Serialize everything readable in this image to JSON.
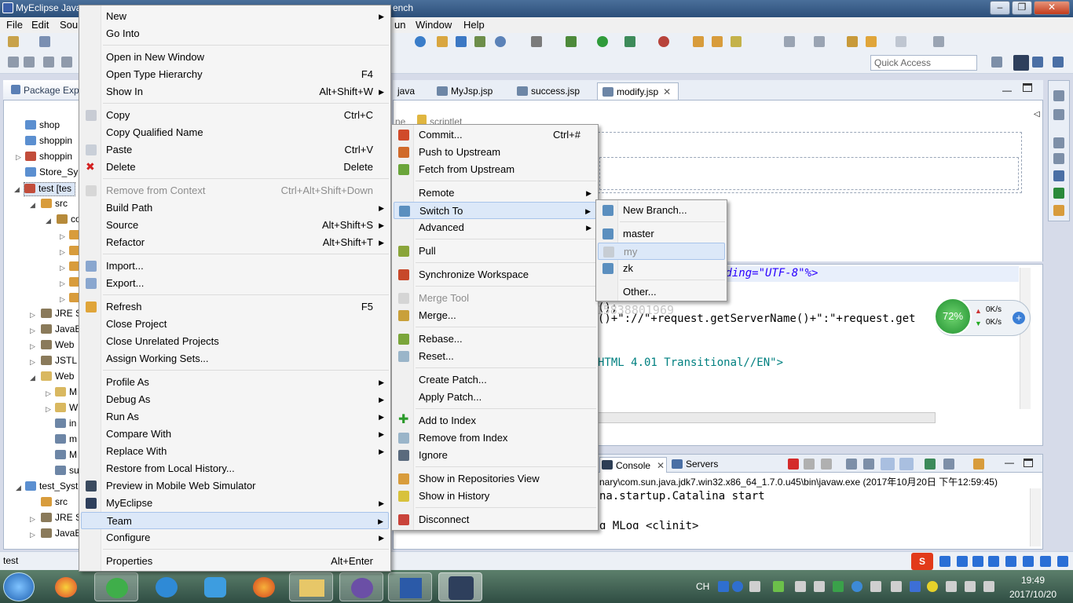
{
  "window": {
    "title": "MyEclipse Java",
    "title_suffix": "ench"
  },
  "menubar": {
    "items": [
      "File",
      "Edit",
      "Sou",
      "un",
      "Window",
      "Help"
    ]
  },
  "toolbar": {
    "quick_access_placeholder": "Quick Access"
  },
  "package_explorer": {
    "title": "Package Expl",
    "rows": [
      "shop",
      "shoppin",
      "shoppin",
      "Store_Sy",
      "test [tes",
      "src",
      "co",
      "",
      "",
      "",
      "",
      "",
      "JRE S",
      "JavaE",
      "Web",
      "JSTL",
      "Web",
      "M",
      "W",
      "in",
      "m",
      "M",
      "su",
      "test_Syst",
      "src",
      "JRE S",
      "JavaE"
    ]
  },
  "editor": {
    "tabs": [
      "java",
      "MyJsp.jsp",
      "success.jsp",
      "modify.jsp"
    ],
    "design_fragments": [
      "ne",
      "scriptlet"
    ],
    "code_lines": [
      "oding=\"UTF-8\"%>",
      "();",
      "()+\"://\"+request.getServerName()+\":\"+request.get",
      "HTML 4.01 Transitional//EN\">"
    ],
    "watermark": "http://blog.csdn.net/a15838801969"
  },
  "console": {
    "tabs": [
      "Console",
      "Servers"
    ],
    "path_line": "nary\\com.sun.java.jdk7.win32.x86_64_1.7.0.u45\\bin\\javaw.exe (2017年10月20日 下午12:59:45)",
    "lines": [
      "na.startup.Catalina start",
      "g MLog <clinit>"
    ]
  },
  "perf_widget": {
    "percent": "72%",
    "up": "0K/s",
    "down": "0K/s"
  },
  "status": {
    "text": "test"
  },
  "taskbar": {
    "time": "19:49",
    "date": "2017/10/20",
    "lang": "CH"
  },
  "context_menu": {
    "items": [
      {
        "label": "New",
        "shortcut": "",
        "submenu": true
      },
      {
        "label": "Go Into",
        "shortcut": ""
      },
      {
        "label": "Open in New Window",
        "shortcut": ""
      },
      {
        "label": "Open Type Hierarchy",
        "shortcut": "F4"
      },
      {
        "label": "Show In",
        "shortcut": "Alt+Shift+W",
        "submenu": true
      },
      {
        "label": "Copy",
        "shortcut": "Ctrl+C"
      },
      {
        "label": "Copy Qualified Name",
        "shortcut": ""
      },
      {
        "label": "Paste",
        "shortcut": "Ctrl+V"
      },
      {
        "label": "Delete",
        "shortcut": "Delete"
      },
      {
        "label": "Remove from Context",
        "shortcut": "Ctrl+Alt+Shift+Down",
        "disabled": true
      },
      {
        "label": "Build Path",
        "shortcut": "",
        "submenu": true
      },
      {
        "label": "Source",
        "shortcut": "Alt+Shift+S",
        "submenu": true
      },
      {
        "label": "Refactor",
        "shortcut": "Alt+Shift+T",
        "submenu": true
      },
      {
        "label": "Import...",
        "shortcut": ""
      },
      {
        "label": "Export...",
        "shortcut": ""
      },
      {
        "label": "Refresh",
        "shortcut": "F5"
      },
      {
        "label": "Close Project",
        "shortcut": ""
      },
      {
        "label": "Close Unrelated Projects",
        "shortcut": ""
      },
      {
        "label": "Assign Working Sets...",
        "shortcut": ""
      },
      {
        "label": "Profile As",
        "shortcut": "",
        "submenu": true
      },
      {
        "label": "Debug As",
        "shortcut": "",
        "submenu": true
      },
      {
        "label": "Run As",
        "shortcut": "",
        "submenu": true
      },
      {
        "label": "Compare With",
        "shortcut": "",
        "submenu": true
      },
      {
        "label": "Replace With",
        "shortcut": "",
        "submenu": true
      },
      {
        "label": "Restore from Local History...",
        "shortcut": ""
      },
      {
        "label": "Preview in Mobile Web Simulator",
        "shortcut": ""
      },
      {
        "label": "MyEclipse",
        "shortcut": "",
        "submenu": true
      },
      {
        "label": "Team",
        "shortcut": "",
        "submenu": true,
        "highlighted": true
      },
      {
        "label": "Configure",
        "shortcut": "",
        "submenu": true
      },
      {
        "label": "Properties",
        "shortcut": "Alt+Enter"
      }
    ]
  },
  "team_menu": {
    "items": [
      {
        "label": "Commit...",
        "shortcut": "Ctrl+#"
      },
      {
        "label": "Push to Upstream",
        "shortcut": ""
      },
      {
        "label": "Fetch from Upstream",
        "shortcut": ""
      },
      {
        "label": "Remote",
        "shortcut": "",
        "submenu": true
      },
      {
        "label": "Switch To",
        "shortcut": "",
        "submenu": true,
        "highlighted": true
      },
      {
        "label": "Advanced",
        "shortcut": "",
        "submenu": true
      },
      {
        "label": "Pull",
        "shortcut": ""
      },
      {
        "label": "Synchronize Workspace",
        "shortcut": ""
      },
      {
        "label": "Merge Tool",
        "shortcut": "",
        "disabled": true
      },
      {
        "label": "Merge...",
        "shortcut": ""
      },
      {
        "label": "Rebase...",
        "shortcut": ""
      },
      {
        "label": "Reset...",
        "shortcut": ""
      },
      {
        "label": "Create Patch...",
        "shortcut": ""
      },
      {
        "label": "Apply Patch...",
        "shortcut": ""
      },
      {
        "label": "Add to Index",
        "shortcut": ""
      },
      {
        "label": "Remove from Index",
        "shortcut": ""
      },
      {
        "label": "Ignore",
        "shortcut": ""
      },
      {
        "label": "Show in Repositories View",
        "shortcut": ""
      },
      {
        "label": "Show in History",
        "shortcut": ""
      },
      {
        "label": "Disconnect",
        "shortcut": ""
      }
    ]
  },
  "switch_menu": {
    "items": [
      {
        "label": "New Branch...",
        "shortcut": ""
      },
      {
        "label": "master",
        "shortcut": ""
      },
      {
        "label": "my",
        "shortcut": "",
        "disabled": true,
        "highlighted": true
      },
      {
        "label": "zk",
        "shortcut": ""
      },
      {
        "label": "Other...",
        "shortcut": ""
      }
    ]
  }
}
